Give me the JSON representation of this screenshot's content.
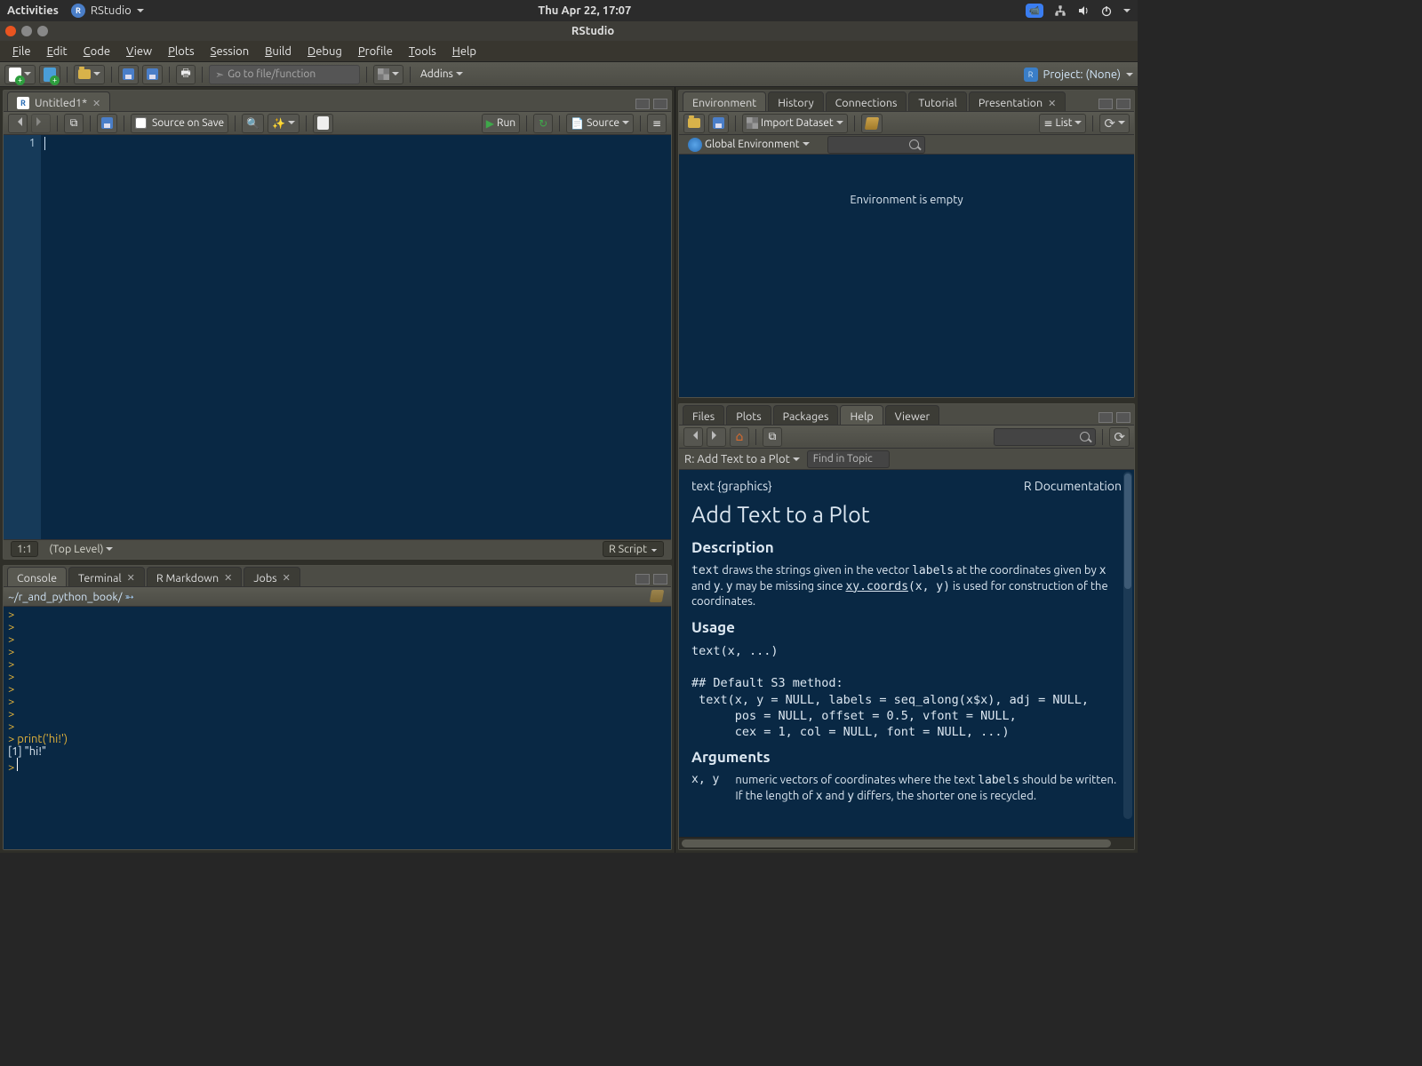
{
  "sysbar": {
    "activities": "Activities",
    "app": "RStudio",
    "clock": "Thu Apr 22, 17:07"
  },
  "titlebar": {
    "title": "RStudio"
  },
  "menubar": [
    "File",
    "Edit",
    "Code",
    "View",
    "Plots",
    "Session",
    "Build",
    "Debug",
    "Profile",
    "Tools",
    "Help"
  ],
  "toolbar": {
    "gotofile": "Go to file/function",
    "addins": "Addins",
    "project": "Project: (None)"
  },
  "source": {
    "tab": "Untitled1*",
    "source_on_save": "Source on Save",
    "run": "Run",
    "source_btn": "Source",
    "gutter": "1",
    "status_pos": "1:1",
    "status_scope": "(Top Level)",
    "status_lang": "R Script"
  },
  "console": {
    "tabs": [
      "Console",
      "Terminal",
      "R Markdown",
      "Jobs"
    ],
    "path": "~/r_and_python_book/",
    "lines": [
      {
        "t": "p",
        "v": "> "
      },
      {
        "t": "p",
        "v": "> "
      },
      {
        "t": "p",
        "v": "> "
      },
      {
        "t": "p",
        "v": "> "
      },
      {
        "t": "p",
        "v": "> "
      },
      {
        "t": "p",
        "v": "> "
      },
      {
        "t": "p",
        "v": "> "
      },
      {
        "t": "p",
        "v": "> "
      },
      {
        "t": "p",
        "v": "> "
      },
      {
        "t": "p",
        "v": "> "
      },
      {
        "t": "c",
        "v": "> print('hi!')"
      },
      {
        "t": "o",
        "v": "[1] \"hi!\""
      },
      {
        "t": "p",
        "v": "> "
      }
    ]
  },
  "env": {
    "tabs": [
      "Environment",
      "History",
      "Connections",
      "Tutorial",
      "Presentation"
    ],
    "import": "Import Dataset",
    "list": "List",
    "scope": "Global Environment",
    "empty": "Environment is empty"
  },
  "help": {
    "tabs": [
      "Files",
      "Plots",
      "Packages",
      "Help",
      "Viewer"
    ],
    "breadcrumb": "R: Add Text to a Plot",
    "find_ph": "Find in Topic",
    "pkg": "text {graphics}",
    "rdoc": "R Documentation",
    "title": "Add Text to a Plot",
    "h_desc": "Description",
    "desc_1": "text",
    "desc_2": " draws the strings given in the vector ",
    "desc_3": "labels",
    "desc_4": " at the coordinates given by ",
    "desc_5": "x",
    "desc_6": " and ",
    "desc_7": "y",
    "desc_8": ". ",
    "desc_9": "y",
    "desc_10": " may be missing since ",
    "desc_link": "xy.coords",
    "desc_11": "(x, y)",
    "desc_12": " is used for construction of the coordinates.",
    "h_usage": "Usage",
    "usage": "text(x, ...)\n\n## Default S3 method:\n text(x, y = NULL, labels = seq_along(x$x), adj = NULL,\n      pos = NULL, offset = 0.5, vfont = NULL,\n      cex = 1, col = NULL, font = NULL, ...)",
    "h_args": "Arguments",
    "arg_k": "x, y",
    "arg_v1": "numeric vectors of coordinates where the text ",
    "arg_v2": "labels",
    "arg_v3": " should be written. If the length of ",
    "arg_v4": "x",
    "arg_v5": " and ",
    "arg_v6": "y",
    "arg_v7": " differs, the shorter one is recycled."
  }
}
